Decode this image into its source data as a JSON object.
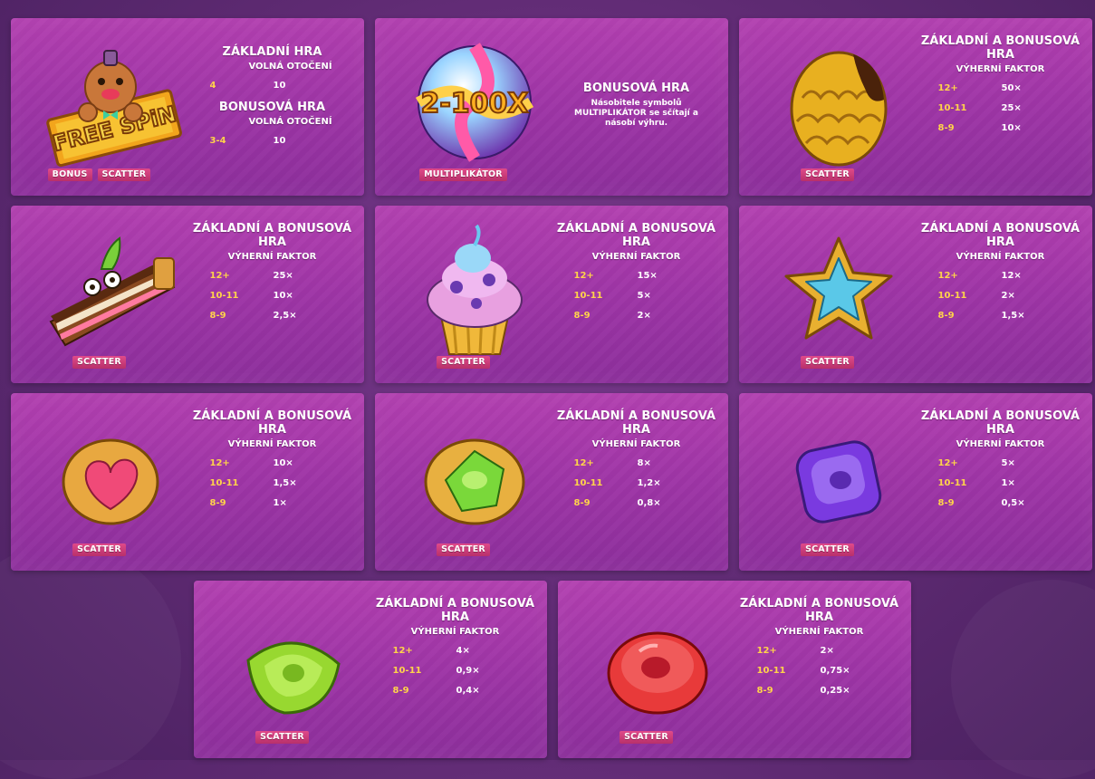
{
  "colors": {
    "card": "#a23aa8",
    "tag": "#d0407c",
    "count": "#ffd34a",
    "background": "#5e2a72"
  },
  "cards": [
    {
      "symbol": "gingerbread-free-spin-icon",
      "tags": [
        "BONUS",
        "SCATTER"
      ],
      "base_title": "ZÁKLADNÍ HRA",
      "base_subtitle": "VOLNÁ OTOČENÍ",
      "base_rows": [
        {
          "count": "4",
          "value": "10"
        }
      ],
      "bonus_title": "BONUSOVÁ HRA",
      "bonus_subtitle": "VOLNÁ OTOČENÍ",
      "bonus_rows": [
        {
          "count": "3-4",
          "value": "10"
        }
      ]
    },
    {
      "symbol": "multiplier-candy-ball-icon",
      "tags": [
        "MULTIPLIKÁTOR"
      ],
      "multiplier_label": "2-100X",
      "title": "BONUSOVÁ HRA",
      "description": "Násobitele symbolů MULTIPLIKÁTOR se sčítají a násobí výhru."
    },
    {
      "symbol": "golden-egg-icon",
      "tags": [
        "SCATTER"
      ],
      "title": "ZÁKLADNÍ A BONUSOVÁ HRA",
      "subtitle": "VÝHERNÍ FAKTOR",
      "rows": [
        {
          "count": "12+",
          "value": "50×"
        },
        {
          "count": "10-11",
          "value": "25×"
        },
        {
          "count": "8-9",
          "value": "10×"
        }
      ]
    },
    {
      "symbol": "cake-slice-icon",
      "tags": [
        "SCATTER"
      ],
      "title": "ZÁKLADNÍ A BONUSOVÁ HRA",
      "subtitle": "VÝHERNÍ FAKTOR",
      "rows": [
        {
          "count": "12+",
          "value": "25×"
        },
        {
          "count": "10-11",
          "value": "10×"
        },
        {
          "count": "8-9",
          "value": "2,5×"
        }
      ]
    },
    {
      "symbol": "cupcake-icon",
      "tags": [
        "SCATTER"
      ],
      "title": "ZÁKLADNÍ A BONUSOVÁ HRA",
      "subtitle": "VÝHERNÍ FAKTOR",
      "rows": [
        {
          "count": "12+",
          "value": "15×"
        },
        {
          "count": "10-11",
          "value": "5×"
        },
        {
          "count": "8-9",
          "value": "2×"
        }
      ]
    },
    {
      "symbol": "star-cookie-icon",
      "tags": [
        "SCATTER"
      ],
      "title": "ZÁKLADNÍ A BONUSOVÁ HRA",
      "subtitle": "VÝHERNÍ FAKTOR",
      "rows": [
        {
          "count": "12+",
          "value": "12×"
        },
        {
          "count": "10-11",
          "value": "2×"
        },
        {
          "count": "8-9",
          "value": "1,5×"
        }
      ]
    },
    {
      "symbol": "heart-cookie-icon",
      "tags": [
        "SCATTER"
      ],
      "title": "ZÁKLADNÍ A BONUSOVÁ HRA",
      "subtitle": "VÝHERNÍ FAKTOR",
      "rows": [
        {
          "count": "12+",
          "value": "10×"
        },
        {
          "count": "10-11",
          "value": "1,5×"
        },
        {
          "count": "8-9",
          "value": "1×"
        }
      ]
    },
    {
      "symbol": "green-jam-cookie-icon",
      "tags": [
        "SCATTER"
      ],
      "title": "ZÁKLADNÍ A BONUSOVÁ HRA",
      "subtitle": "VÝHERNÍ FAKTOR",
      "rows": [
        {
          "count": "12+",
          "value": "8×"
        },
        {
          "count": "10-11",
          "value": "1,2×"
        },
        {
          "count": "8-9",
          "value": "0,8×"
        }
      ]
    },
    {
      "symbol": "purple-candy-icon",
      "tags": [
        "SCATTER"
      ],
      "title": "ZÁKLADNÍ A BONUSOVÁ HRA",
      "subtitle": "VÝHERNÍ FAKTOR",
      "rows": [
        {
          "count": "12+",
          "value": "5×"
        },
        {
          "count": "10-11",
          "value": "1×"
        },
        {
          "count": "8-9",
          "value": "0,5×"
        }
      ]
    },
    {
      "symbol": "green-candy-icon",
      "tags": [
        "SCATTER"
      ],
      "title": "ZÁKLADNÍ A BONUSOVÁ HRA",
      "subtitle": "VÝHERNÍ FAKTOR",
      "rows": [
        {
          "count": "12+",
          "value": "4×"
        },
        {
          "count": "10-11",
          "value": "0,9×"
        },
        {
          "count": "8-9",
          "value": "0,4×"
        }
      ]
    },
    {
      "symbol": "red-candy-icon",
      "tags": [
        "SCATTER"
      ],
      "title": "ZÁKLADNÍ A BONUSOVÁ HRA",
      "subtitle": "VÝHERNÍ FAKTOR",
      "rows": [
        {
          "count": "12+",
          "value": "2×"
        },
        {
          "count": "10-11",
          "value": "0,75×"
        },
        {
          "count": "8-9",
          "value": "0,25×"
        }
      ]
    }
  ]
}
